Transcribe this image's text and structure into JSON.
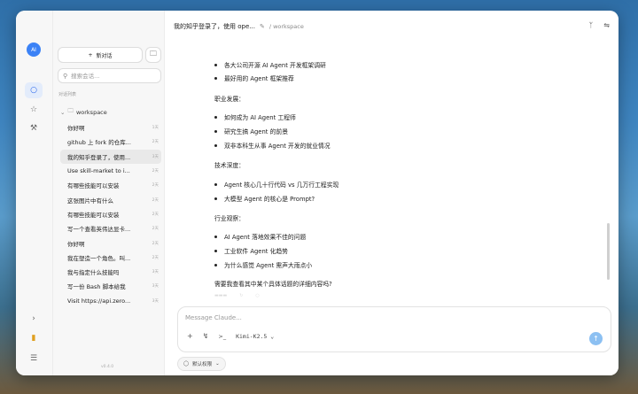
{
  "sidebar_rail": {
    "logo": "AI",
    "icons": [
      "chat-icon",
      "star-icon",
      "wrench-icon"
    ],
    "bottom_icons": [
      "chevron-right-icon",
      "trophy-icon",
      "sliders-icon"
    ]
  },
  "sidebar": {
    "new_chat_label": "新对话",
    "search_placeholder": "搜索会话...",
    "section_label": "对话列表",
    "folder_name": "workspace",
    "conversations": [
      {
        "title": "你好啊",
        "date": "1天"
      },
      {
        "title": "github 上 fork 的仓库...",
        "date": "2天"
      },
      {
        "title": "我的知乎登录了，使用...",
        "date": "3天"
      },
      {
        "title": "Use skill-market to i...",
        "date": "2天"
      },
      {
        "title": "有哪些技能可以安装",
        "date": "2天"
      },
      {
        "title": "这张图片中有什么",
        "date": "2天"
      },
      {
        "title": "有哪些技能可以安装",
        "date": "2天"
      },
      {
        "title": "写一个查看英伟达显卡...",
        "date": "2天"
      },
      {
        "title": "你好啊",
        "date": "2天"
      },
      {
        "title": "我在塑造一个角色。叫...",
        "date": "2天"
      },
      {
        "title": "我与指定什么技能吗",
        "date": "3天"
      },
      {
        "title": "写一份 Bash 脚本给我",
        "date": "3天"
      },
      {
        "title": "Visit https://api.zero...",
        "date": "3天"
      }
    ],
    "version": "v0.4.0"
  },
  "header": {
    "title": "我的知乎登录了，使用 ope...",
    "breadcrumb": "/ workspace"
  },
  "message": {
    "list_a": [
      "各大公司开源 AI Agent 开发框架调研",
      "最好用的 Agent 框架推荐"
    ],
    "career_heading": "职业发展：",
    "career_items": [
      "如何成为 AI Agent 工程师",
      "研究生搞 Agent 的前景",
      "双非本科生从事 Agent 开发的就业情况"
    ],
    "tech_heading": "技术深度：",
    "tech_items": [
      "Agent 核心几十行代码 vs 几万行工程实现",
      "大模型 Agent 的核心是 Prompt?"
    ],
    "industry_heading": "行业观察：",
    "industry_items": [
      "AI Agent 落地效果不佳的问题",
      "工业软件 Agent 化趋势",
      "为什么感觉 Agent 需声大雨点小"
    ],
    "question": "需要我查看其中某个具体话题的详细内容吗?"
  },
  "composer": {
    "placeholder": "Message Claude...",
    "model": "Kimi-K2.5"
  },
  "permission_label": "默认权限"
}
